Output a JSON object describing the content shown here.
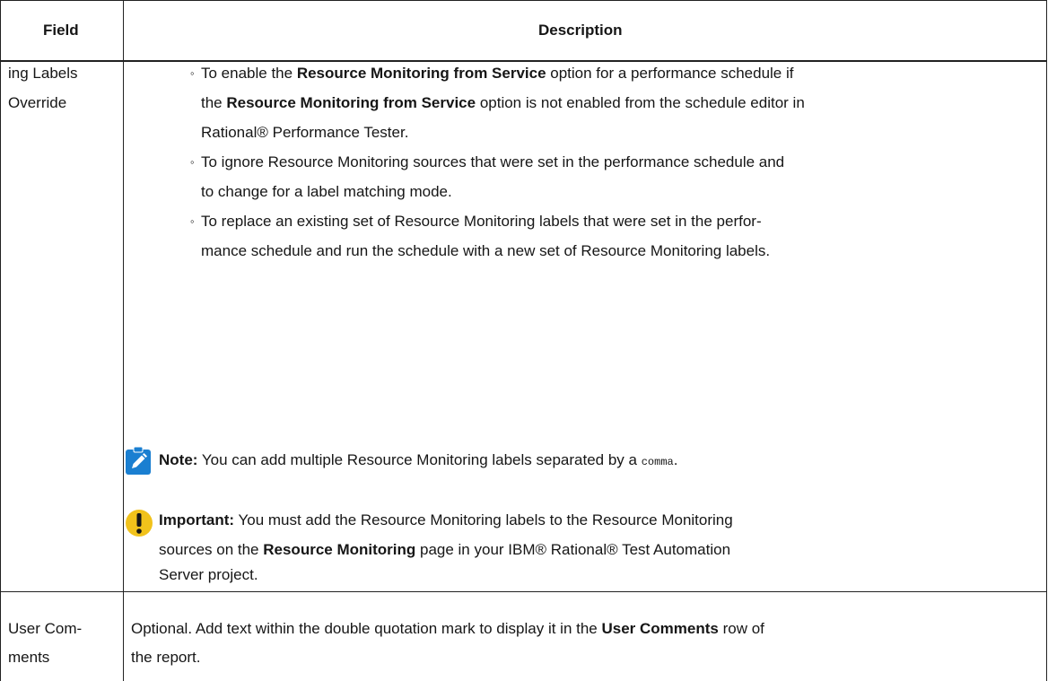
{
  "header": {
    "field": "Field",
    "description": "Description"
  },
  "row1": {
    "field_lines": [
      "ing Labels",
      "Override"
    ],
    "bullets": [
      {
        "parts": [
          {
            "t": "To enable the ",
            "b": false
          },
          {
            "t": "Resource Monitoring from Service",
            "b": true
          },
          {
            "t": " option for a performance schedule if",
            "b": false
          }
        ],
        "line2": [
          {
            "t": "the ",
            "b": false
          },
          {
            "t": "Resource Monitoring from Service",
            "b": true
          },
          {
            "t": " option is not enabled from the schedule editor in",
            "b": false
          }
        ],
        "line3": "Rational® Performance Tester."
      },
      {
        "line1": "To ignore Resource Monitoring sources that were set in the performance schedule and",
        "line2": "to change for a label matching mode."
      },
      {
        "line1": "To replace an existing set of Resource Monitoring labels that were set in the perfor-",
        "line2": "mance schedule and run the schedule with a new set of Resource Monitoring labels."
      }
    ],
    "note": {
      "label": "Note:",
      "text": " You can add multiple Resource Monitoring labels separated by a ",
      "code": "comma",
      "end": "."
    },
    "important": {
      "label": "Important:",
      "line1": " You must add the Resource Monitoring labels to the Resource Monitoring",
      "line2_pre": "sources on the ",
      "line2_bold": "Resource Monitoring",
      "line2_post": " page in your IBM® Rational® Test Automation",
      "line3": "Server project."
    }
  },
  "row2": {
    "field_lines": [
      "User Com-",
      "ments"
    ],
    "line1_pre": "Optional. Add text within the double quotation mark to display it in the ",
    "line1_bold": "User Comments",
    "line1_post": " row of",
    "line2": "the report."
  },
  "colors": {
    "note_icon": "#1a7fd1",
    "important_icon": "#f1c21b",
    "border": "#222222"
  }
}
